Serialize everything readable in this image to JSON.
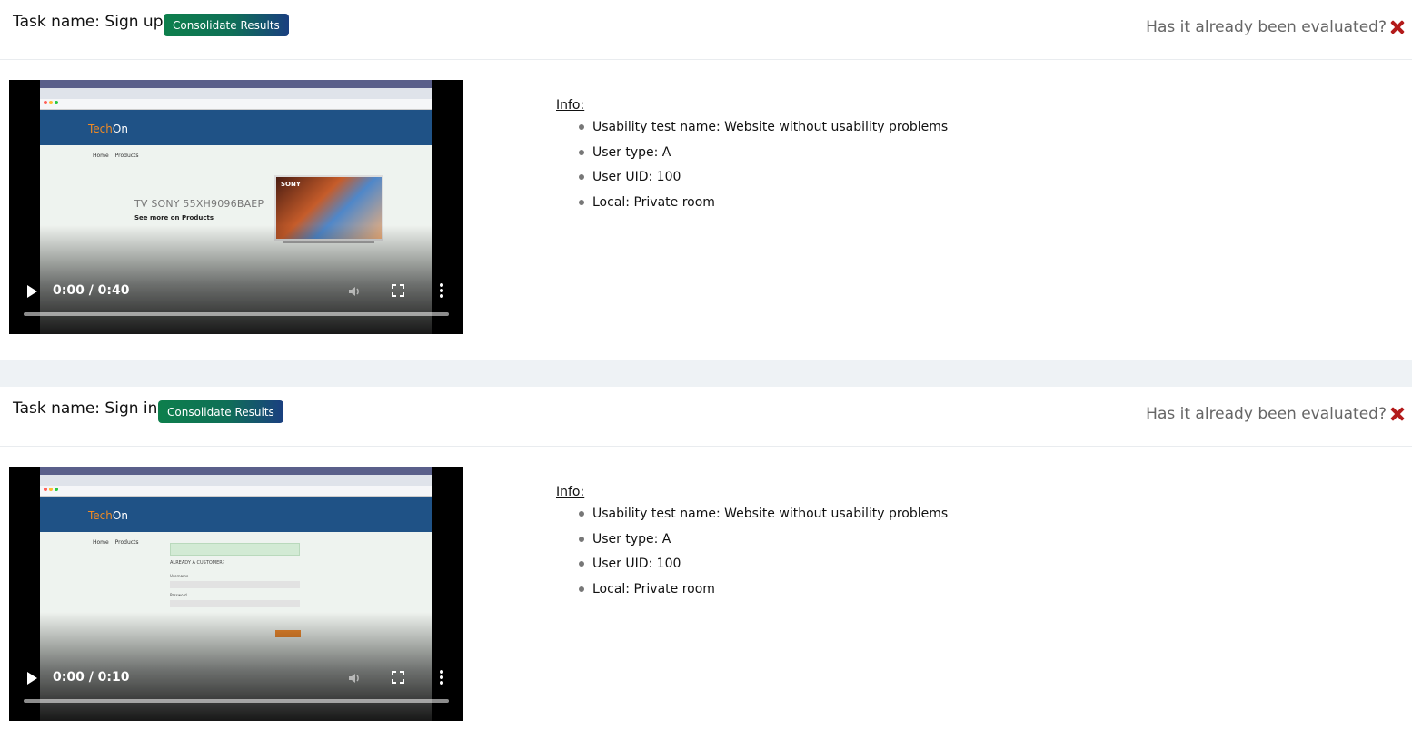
{
  "tasks": [
    {
      "title": "Task name: Sign up",
      "consolidate_label": "Consolidate Results",
      "evaluated_label": "Has it already been evaluated?",
      "video": {
        "time": "0:00 / 0:40",
        "site_logo_tech": "Tech",
        "site_logo_on": "On",
        "site_nav": "Home Products",
        "hero_title": "TV SONY 55XH9096BAEP",
        "hero_subtitle": "See more on Products",
        "tv_brand": "SONY"
      },
      "info": {
        "heading": "Info:",
        "items": [
          "Usability test name: Website without usability problems",
          "User type: A",
          "User UID: 100",
          "Local: Private room"
        ]
      }
    },
    {
      "title": "Task name: Sign in",
      "consolidate_label": "Consolidate Results",
      "evaluated_label": "Has it already been evaluated?",
      "video": {
        "time": "0:00 / 0:10",
        "site_logo_tech": "Tech",
        "site_logo_on": "On",
        "site_nav": "Home Products",
        "form_heading": "ALREADY A CUSTOMER?",
        "form_username_label": "Username",
        "form_password_label": "Password"
      },
      "info": {
        "heading": "Info:",
        "items": [
          "Usability test name: Website without usability problems",
          "User type: A",
          "User UID: 100",
          "Local: Private room"
        ]
      }
    }
  ],
  "icons": {
    "close": "close-icon",
    "play": "play-icon",
    "volume": "volume-icon",
    "fullscreen": "fullscreen-icon",
    "more": "more-options-icon"
  },
  "colors": {
    "close_x": "#b31b1b",
    "button_start": "#0d7f4c",
    "button_end": "#1a3f80",
    "site_header": "#1f5286",
    "logo_accent": "#f08a24",
    "divider_band": "#eef2f5"
  }
}
